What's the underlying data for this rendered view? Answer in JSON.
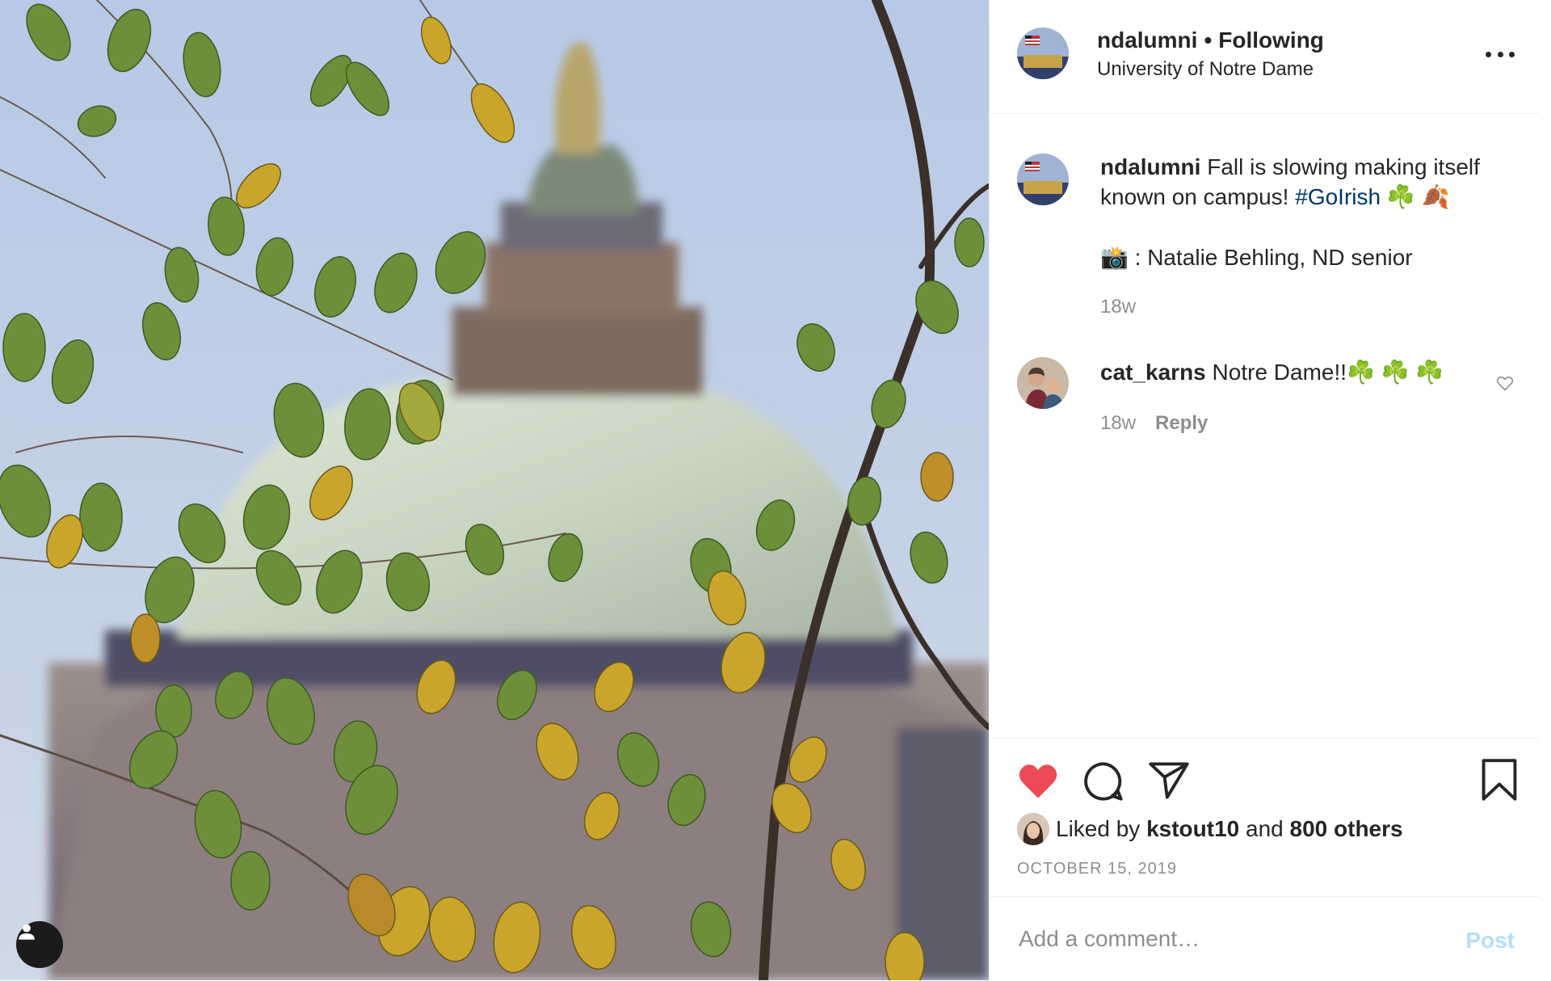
{
  "header": {
    "username": "ndalumni",
    "separator": "•",
    "follow_status": "Following",
    "location": "University of Notre Dame"
  },
  "caption": {
    "username": "ndalumni",
    "text": "Fall is slowing making itself known on campus!",
    "hashtag": "#GoIrish",
    "emoji": "☘️ 🍂",
    "credit": "📸 : Natalie Behling, ND senior",
    "time": "18w"
  },
  "comments": [
    {
      "username": "cat_karns",
      "text": "Notre Dame!!☘️ ☘️ ☘️",
      "time": "18w",
      "reply_label": "Reply"
    }
  ],
  "likes": {
    "prefix": "Liked by",
    "user": "kstout10",
    "middle": "and",
    "others": "800 others"
  },
  "date": "OCTOBER 15, 2019",
  "comment_box": {
    "placeholder": "Add a comment…",
    "post_label": "Post"
  },
  "colors": {
    "like_red": "#ed4956",
    "hashtag_blue": "#00376b",
    "post_disabled": "#b2dffc",
    "muted_text": "#8e8e8e"
  },
  "icons": {
    "like": "heart-filled-icon",
    "comment": "comment-bubble-icon",
    "share": "paper-plane-icon",
    "save": "bookmark-icon",
    "more": "more-dots-icon",
    "tag": "user-tag-icon",
    "comment_like": "heart-outline-icon"
  }
}
